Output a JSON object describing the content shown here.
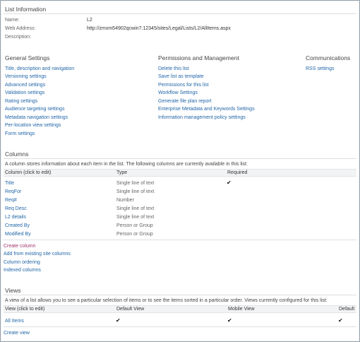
{
  "list_info": {
    "heading": "List Information",
    "name_label": "Name:",
    "name_value": "L2",
    "address_label": "Web Address:",
    "address_value": "http://zmxm54902qcwin7:12345/sites/Legal/Lists/L2/AllItems.aspx",
    "description_label": "Description:"
  },
  "general_settings": {
    "heading": "General Settings",
    "items": [
      "Title, description and navigation",
      "Versioning settings",
      "Advanced settings",
      "Validation settings",
      "Rating settings",
      "Audience targeting settings",
      "Metadata navigation settings",
      "Per-location view settings",
      "Form settings"
    ]
  },
  "permissions": {
    "heading": "Permissions and Management",
    "items": [
      "Delete this list",
      "Save list as template",
      "Permissions for this list",
      "Workflow Settings",
      "Generate file plan report",
      "Enterprise Metadata and Keywords Settings",
      "Information management policy settings"
    ]
  },
  "communications": {
    "heading": "Communications",
    "items": [
      "RSS settings"
    ]
  },
  "columns": {
    "heading": "Columns",
    "description": "A column stores information about each item in the list. The following columns are currently available in this list:",
    "headers": [
      "Column (click to edit)",
      "Type",
      "Required"
    ],
    "rows": [
      {
        "name": "Title",
        "type": "Single line of text",
        "required": "✔"
      },
      {
        "name": "ReqFor",
        "type": "Single line of text",
        "required": ""
      },
      {
        "name": "Req#",
        "type": "Number",
        "required": ""
      },
      {
        "name": "Req Desc",
        "type": "Single line of text",
        "required": ""
      },
      {
        "name": "L2 details",
        "type": "Single line of text",
        "required": ""
      },
      {
        "name": "Created By",
        "type": "Person or Group",
        "required": ""
      },
      {
        "name": "Modified By",
        "type": "Person or Group",
        "required": ""
      }
    ],
    "actions": [
      "Create column",
      "Add from existing site columns",
      "Column ordering",
      "Indexed columns"
    ]
  },
  "views": {
    "heading": "Views",
    "description": "A view of a list allows you to see a particular selection of items or to see the items sorted in a particular order. Views currently configured for this list:",
    "headers": [
      "View (click to edit)",
      "Default View",
      "Mobile View",
      "Default"
    ],
    "rows": [
      {
        "name": "All Items",
        "default_view": "✔",
        "mobile_view": "✔",
        "default": "✔"
      }
    ],
    "actions": [
      "Create view"
    ]
  },
  "colors": {
    "link": "#2266a8",
    "create_link": "#a13770",
    "text": "#444444",
    "border": "#9aa3ac",
    "header_bg": "#f2f3f4"
  }
}
